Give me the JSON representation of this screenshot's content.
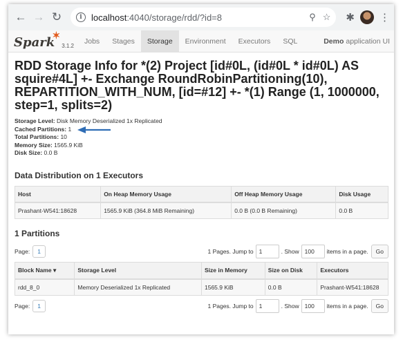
{
  "browser": {
    "url_host": "localhost",
    "url_path": ":4040/storage/rdd/?id=8"
  },
  "spark_nav": {
    "logo": "Spark",
    "version": "3.1.2",
    "tabs": [
      "Jobs",
      "Stages",
      "Storage",
      "Environment",
      "Executors",
      "SQL"
    ],
    "active_tab": "Storage",
    "app_bold": "Demo",
    "app_rest": "application UI"
  },
  "page": {
    "title": "RDD Storage Info for *(2) Project [id#0L, (id#0L * id#0L) AS squire#4L] +- Exchange RoundRobinPartitioning(10), REPARTITION_WITH_NUM, [id=#12] +- *(1) Range (1, 1000000, step=1, splits=2)"
  },
  "summary": [
    {
      "label": "Storage Level:",
      "value": "Disk Memory Deserialized 1x Replicated"
    },
    {
      "label": "Cached Partitions:",
      "value": "1"
    },
    {
      "label": "Total Partitions:",
      "value": "10"
    },
    {
      "label": "Memory Size:",
      "value": "1565.9 KiB"
    },
    {
      "label": "Disk Size:",
      "value": "0.0 B"
    }
  ],
  "distribution": {
    "heading": "Data Distribution on 1 Executors",
    "headers": [
      "Host",
      "On Heap Memory Usage",
      "Off Heap Memory Usage",
      "Disk Usage"
    ],
    "rows": [
      [
        "Prashant-W541:18628",
        "1565.9 KiB (364.8 MiB Remaining)",
        "0.0 B (0.0 B Remaining)",
        "0.0 B"
      ]
    ]
  },
  "partitions": {
    "heading": "1 Partitions",
    "headers": [
      "Block Name",
      "Storage Level",
      "Size in Memory",
      "Size on Disk",
      "Executors"
    ],
    "sort_indicator": "▾",
    "rows": [
      [
        "rdd_8_0",
        "Memory Deserialized 1x Replicated",
        "1565.9 KiB",
        "0.0 B",
        "Prashant-W541:18628"
      ]
    ]
  },
  "pager": {
    "page_label": "Page:",
    "current_page": "1",
    "pages_text": "1 Pages. Jump to",
    "jump_value": "1",
    "show_text": ". Show",
    "show_value": "100",
    "items_text": "items in a page.",
    "go_label": "Go"
  },
  "colors": {
    "arrow": "#2f6db5",
    "spark_orange": "#e25a1c"
  }
}
